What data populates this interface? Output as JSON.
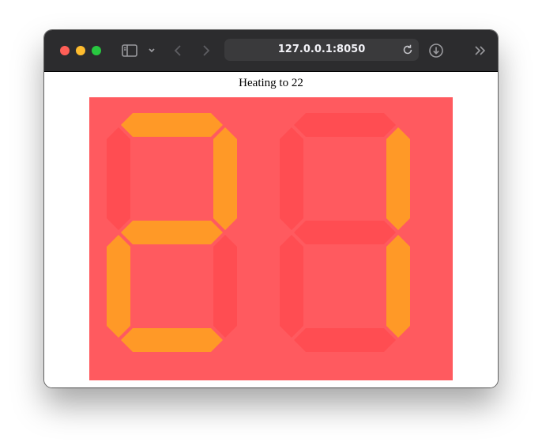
{
  "browser": {
    "url": "127.0.0.1:8050"
  },
  "page": {
    "status_text": "Heating to 22"
  },
  "display": {
    "digits": [
      "2",
      "1"
    ],
    "colors": {
      "background": "#ff5a5f",
      "segment_on": "#ff9927",
      "segment_off": "#ff4d52"
    }
  }
}
